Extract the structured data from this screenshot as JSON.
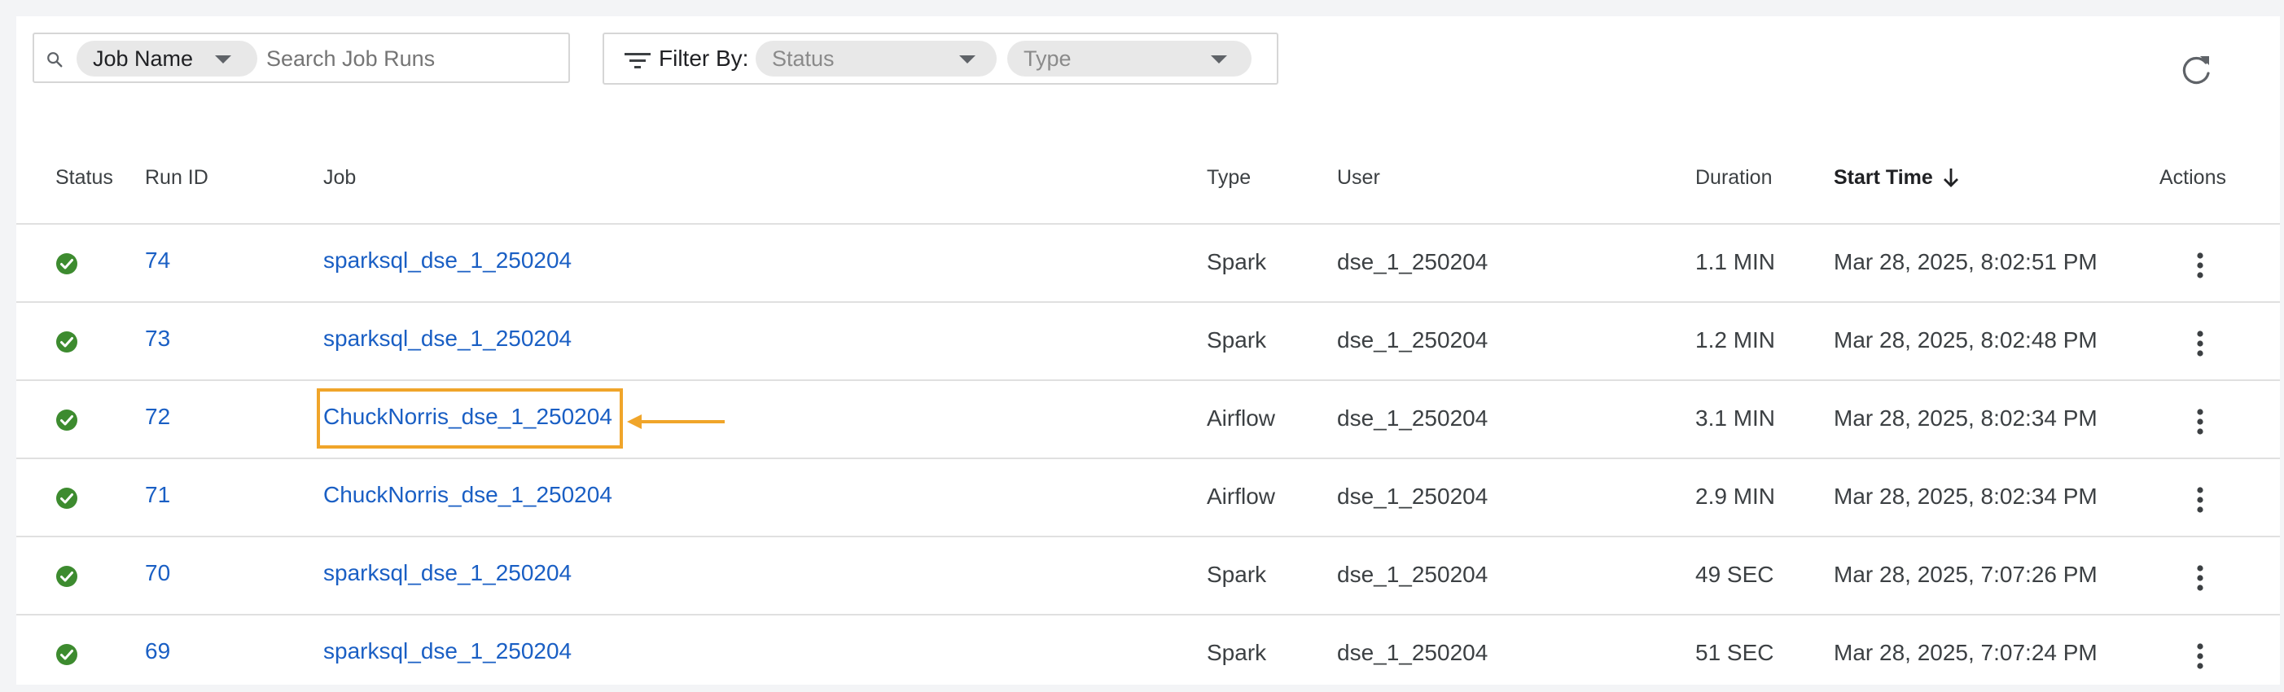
{
  "toolbar": {
    "search_chip_label": "Job Name",
    "search_placeholder": "Search Job Runs",
    "filter_label": "Filter By:",
    "status_placeholder": "Status",
    "type_placeholder": "Type"
  },
  "table": {
    "columns": {
      "status": "Status",
      "run_id": "Run ID",
      "job": "Job",
      "type": "Type",
      "user": "User",
      "duration": "Duration",
      "start_time": "Start Time",
      "actions": "Actions"
    },
    "sort": {
      "column": "start_time",
      "direction": "descending"
    },
    "rows": [
      {
        "status": "success",
        "run_id": "74",
        "job": "sparksql_dse_1_250204",
        "type": "Spark",
        "user": "dse_1_250204",
        "duration": "1.1 MIN",
        "start_time": "Mar 28, 2025, 8:02:51 PM"
      },
      {
        "status": "success",
        "run_id": "73",
        "job": "sparksql_dse_1_250204",
        "type": "Spark",
        "user": "dse_1_250204",
        "duration": "1.2 MIN",
        "start_time": "Mar 28, 2025, 8:02:48 PM"
      },
      {
        "status": "success",
        "run_id": "72",
        "job": "ChuckNorris_dse_1_250204",
        "type": "Airflow",
        "user": "dse_1_250204",
        "duration": "3.1 MIN",
        "start_time": "Mar 28, 2025, 8:02:34 PM"
      },
      {
        "status": "success",
        "run_id": "71",
        "job": "ChuckNorris_dse_1_250204",
        "type": "Airflow",
        "user": "dse_1_250204",
        "duration": "2.9 MIN",
        "start_time": "Mar 28, 2025, 8:02:34 PM"
      },
      {
        "status": "success",
        "run_id": "70",
        "job": "sparksql_dse_1_250204",
        "type": "Spark",
        "user": "dse_1_250204",
        "duration": "49 SEC",
        "start_time": "Mar 28, 2025, 7:07:26 PM"
      },
      {
        "status": "success",
        "run_id": "69",
        "job": "sparksql_dse_1_250204",
        "type": "Spark",
        "user": "dse_1_250204",
        "duration": "51 SEC",
        "start_time": "Mar 28, 2025, 7:07:24 PM"
      }
    ]
  },
  "annotation": {
    "highlighted_row_index": 2,
    "color": "#f0a52a"
  },
  "colors": {
    "link": "#1a5fc4",
    "success": "#3d8b2f",
    "border": "#e0e0e0"
  },
  "icons": {
    "search": "search-icon",
    "filter": "filter-icon",
    "refresh": "refresh-icon",
    "status_success": "check-circle-icon",
    "sort": "arrow-down-icon",
    "actions": "kebab-menu-icon"
  }
}
